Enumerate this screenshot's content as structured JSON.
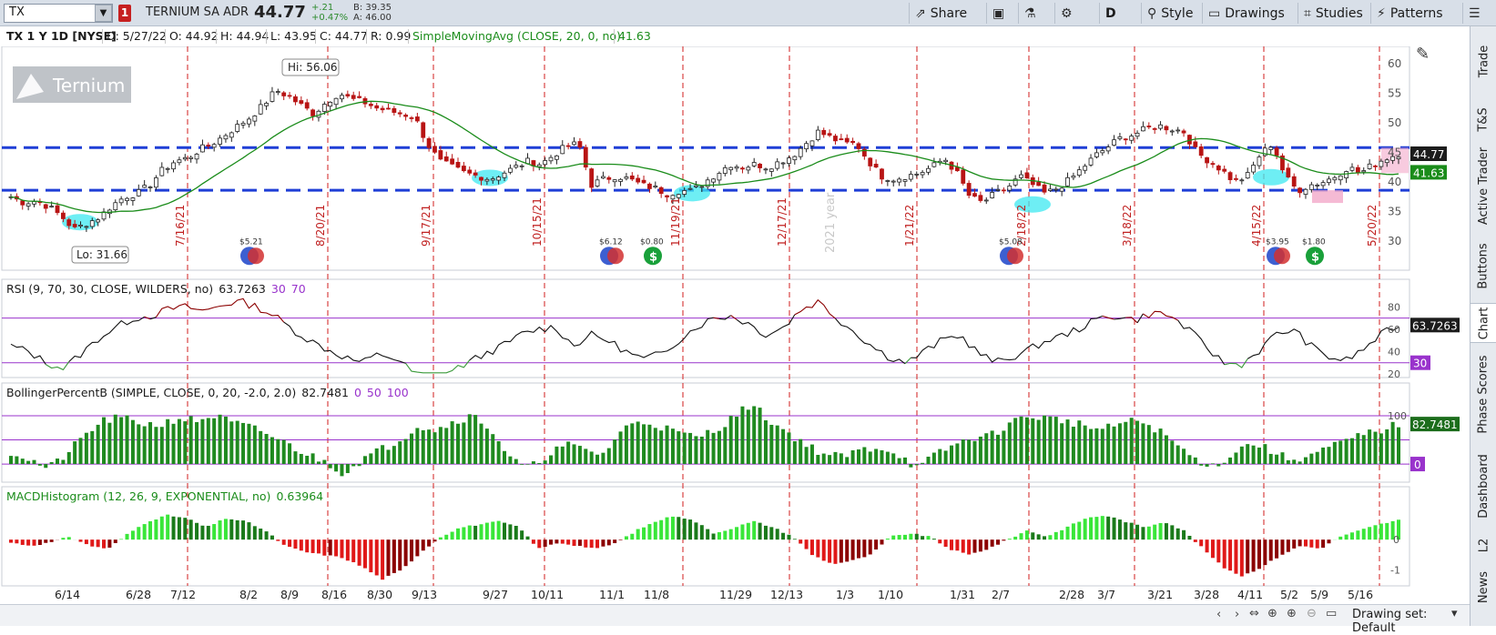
{
  "header": {
    "symbol": "TX",
    "alert_count": "1",
    "description": "TERNIUM SA ADR",
    "last": "44.77",
    "change": "+.21",
    "change_pct": "+0.47%",
    "bid": "B: 39.35",
    "ask": "A: 46.00",
    "share": "Share",
    "timeframe": "D",
    "style": "Style",
    "drawings": "Drawings",
    "studies": "Studies",
    "patterns": "Patterns"
  },
  "info": {
    "title": "TX 1 Y 1D [NYSE]",
    "date": "D: 5/27/22",
    "open": "O: 44.92",
    "high": "H: 44.94",
    "low": "L: 43.95",
    "close": "C: 44.77",
    "range": "R: 0.99",
    "sma_label": "SimpleMovingAvg (CLOSE, 20, 0, no)",
    "sma_value": "41.63"
  },
  "sidebar": [
    "Trade",
    "T&S",
    "Active Trader",
    "Buttons",
    "Chart",
    "Phase Scores",
    "Dashboard",
    "L2",
    "News"
  ],
  "logo": "Ternium",
  "bottom": {
    "drawing_set": "Drawing set: Default"
  },
  "colors": {
    "up": "#2f8f2f",
    "down": "#b81414",
    "sma": "#1a8c1a",
    "hline": "#1f3fd6",
    "vline": "#d21e1e",
    "rsi_upper": "#8b0000",
    "rsi_lower": "#3a9a3a"
  },
  "chart_data": [
    {
      "type": "candlestick",
      "title": "TX 1 Y 1D [NYSE]",
      "x_ticks": [
        "6/14",
        "6/28",
        "7/12",
        "8/2",
        "8/9",
        "8/16",
        "8/30",
        "9/13",
        "9/27",
        "10/11",
        "11/1",
        "11/8",
        "11/29",
        "12/13",
        "1/3",
        "1/10",
        "1/31",
        "2/7",
        "2/28",
        "3/7",
        "3/21",
        "3/28",
        "4/11",
        "5/2",
        "5/9",
        "5/16"
      ],
      "y_ticks": [
        30,
        35,
        40,
        45,
        50,
        55,
        60
      ],
      "ylim": [
        26,
        62
      ],
      "vline_labels": [
        "7/16/21",
        "8/20/21",
        "9/17/21",
        "10/15/21",
        "11/19/21",
        "12/17/21",
        "1/21/22",
        "2/18/22",
        "3/18/22",
        "4/15/22",
        "5/20/22"
      ],
      "year_label": "2021 year",
      "hlines": [
        45.8,
        38.6
      ],
      "annotations": {
        "high": "Hi: 56.06",
        "low": "Lo: 31.66"
      },
      "dividends": [
        "$5.21",
        "$6.12",
        "$0.80",
        "$5.08",
        "$3.95",
        "$1.80"
      ],
      "close_anchors": [
        37.5,
        36.5,
        36.8,
        35.8,
        34.2,
        32.0,
        33.0,
        34.0,
        36.0,
        37.5,
        38.0,
        39.5,
        42.0,
        43.5,
        44.0,
        45.5,
        46.5,
        48.0,
        49.5,
        51.0,
        53.0,
        55.5,
        54.5,
        53.0,
        51.5,
        53.5,
        55.0,
        54.0,
        53.5,
        52.5,
        52.0,
        51.5,
        51.0,
        46.5,
        43.5,
        42.5,
        41.5,
        41.0,
        40.5,
        41.5,
        42.5,
        43.5,
        43.0,
        44.5,
        46.0,
        46.5,
        39.5,
        40.5,
        41.0,
        40.5,
        39.5,
        39.0,
        38.0,
        38.5,
        38.5,
        40.0,
        41.5,
        43.0,
        42.5,
        43.0,
        42.5,
        43.5,
        44.5,
        46.5,
        48.5,
        47.5,
        46.5,
        46.5,
        43.5,
        41.0,
        40.5,
        41.0,
        41.5,
        42.5,
        44.0,
        41.5,
        37.5,
        36.5,
        38.0,
        39.0,
        41.0,
        39.5,
        38.0,
        39.0,
        40.5,
        42.5,
        44.5,
        46.0,
        47.5,
        48.0,
        49.0,
        49.5,
        49.0,
        48.5,
        45.0,
        43.5,
        42.0,
        40.0,
        41.0,
        44.5,
        46.5,
        41.0,
        38.5,
        39.5,
        40.0,
        41.0,
        42.5,
        41.5,
        43.0,
        44.0,
        44.77
      ],
      "legend": "SimpleMovingAvg (CLOSE, 20, 0, no)",
      "last_value": "44.77",
      "sma_last": "41.63",
      "y_label_values": [
        "60",
        "55",
        "50",
        "45",
        "40",
        "35",
        "30"
      ]
    },
    {
      "type": "line",
      "title": "RSI (9, 70, 30, CLOSE, WILDERS, no)",
      "value": "63.7263",
      "levels": [
        "30",
        "70"
      ],
      "ylim": [
        20,
        90
      ],
      "y_ticks": [
        "80",
        "60",
        "40",
        "20"
      ],
      "anchors": [
        45,
        40,
        30,
        25,
        38,
        52,
        62,
        70,
        72,
        78,
        80,
        76,
        82,
        85,
        80,
        72,
        60,
        50,
        42,
        35,
        30,
        38,
        33,
        20,
        15,
        22,
        30,
        38,
        45,
        55,
        60,
        62,
        45,
        55,
        50,
        40,
        33,
        38,
        50,
        62,
        70,
        72,
        65,
        55,
        62,
        78,
        85,
        70,
        58,
        45,
        35,
        30,
        40,
        50,
        55,
        40,
        30,
        35,
        42,
        50,
        55,
        62,
        70,
        72,
        68,
        75,
        72,
        60,
        45,
        30,
        28,
        40,
        55,
        60,
        45,
        35,
        32,
        42,
        55,
        63.7
      ]
    },
    {
      "type": "bar",
      "title": "BollingerPercentB (SIMPLE, CLOSE, 0, 20, -2.0, 2.0)",
      "value": "82.7481",
      "levels": [
        "0",
        "50",
        "100"
      ],
      "ylim": [
        -30,
        130
      ],
      "anchors": [
        25,
        10,
        -10,
        20,
        60,
        90,
        95,
        85,
        80,
        95,
        90,
        100,
        85,
        75,
        60,
        40,
        20,
        5,
        -20,
        10,
        30,
        50,
        80,
        70,
        90,
        100,
        70,
        10,
        -10,
        20,
        40,
        30,
        20,
        70,
        90,
        80,
        65,
        55,
        70,
        95,
        125,
        90,
        65,
        40,
        20,
        15,
        30,
        35,
        20,
        -10,
        20,
        40,
        55,
        60,
        85,
        100,
        95,
        90,
        80,
        70,
        85,
        90,
        70,
        40,
        10,
        -5,
        20,
        45,
        30,
        10,
        15,
        30,
        45,
        60,
        70,
        82.7
      ]
    },
    {
      "type": "bar",
      "title": "MACDHistogram (12, 26, 9, EXPONENTIAL, no)",
      "value": "0.63964",
      "ylim": [
        -1.4,
        1.2
      ],
      "y_ticks": [
        "0",
        "-1"
      ],
      "anchors": [
        -0.1,
        -0.2,
        -0.1,
        0.1,
        -0.2,
        -0.3,
        0.2,
        0.6,
        0.8,
        0.7,
        0.4,
        0.7,
        0.6,
        0.3,
        -0.2,
        -0.4,
        -0.5,
        -0.6,
        -0.9,
        -1.3,
        -1.0,
        -0.4,
        0.1,
        0.4,
        0.5,
        0.6,
        0.4,
        -0.3,
        -0.1,
        -0.2,
        -0.3,
        -0.1,
        0.3,
        0.6,
        0.8,
        0.6,
        0.2,
        0.4,
        0.6,
        0.4,
        0.1,
        -0.5,
        -0.8,
        -0.7,
        -0.5,
        0.1,
        0.2,
        0.1,
        -0.3,
        -0.5,
        -0.3,
        0.0,
        0.3,
        0.1,
        0.4,
        0.7,
        0.8,
        0.6,
        0.4,
        0.6,
        0.3,
        -0.3,
        -0.9,
        -1.2,
        -0.9,
        -0.5,
        -0.2,
        -0.3,
        0.1,
        0.3,
        0.5,
        0.64
      ]
    }
  ]
}
